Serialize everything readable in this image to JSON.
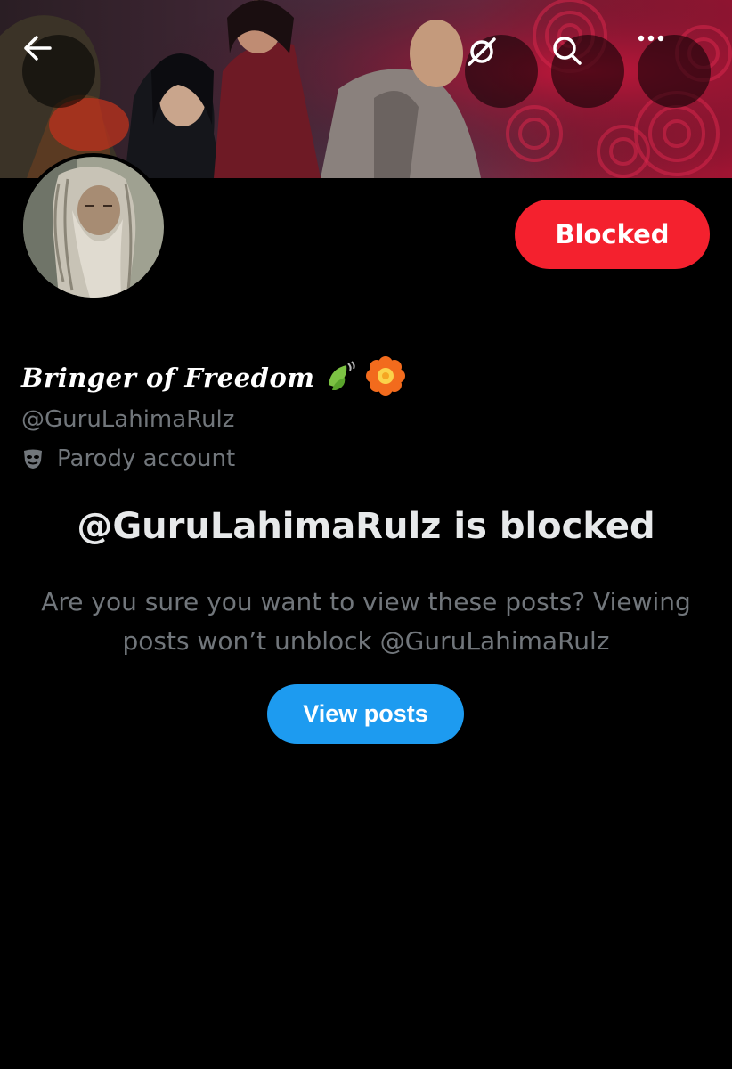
{
  "profile": {
    "display_name": "Bringer of Freedom",
    "handle": "@GuruLahimaRulz",
    "label": "Parody account"
  },
  "header": {
    "back_icon": "back-arrow-icon",
    "grok_icon": "grok-icon",
    "search_icon": "search-icon",
    "more_icon": "more-icon",
    "blocked_button_label": "Blocked"
  },
  "blocked_notice": {
    "title": "@GuruLahimaRulz is blocked",
    "description": "Are you sure you want to view these posts? Viewing posts won’t unblock @GuruLahimaRulz",
    "view_posts_label": "View posts"
  },
  "colors": {
    "background": "#000000",
    "blocked_red": "#f4212e",
    "view_blue": "#1d9bf0",
    "secondary_text": "#71767b"
  }
}
